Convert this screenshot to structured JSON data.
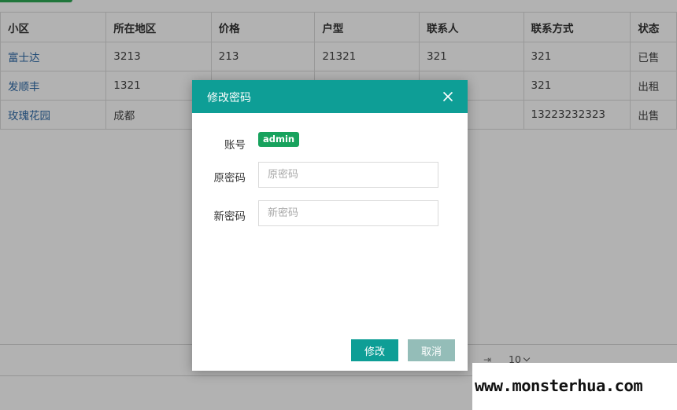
{
  "table": {
    "headers": [
      "小区",
      "所在地区",
      "价格",
      "户型",
      "联系人",
      "联系方式",
      "状态"
    ],
    "rows": [
      [
        "富士达",
        "3213",
        "213",
        "21321",
        "321",
        "321",
        "已售"
      ],
      [
        "发顺丰",
        "1321",
        "",
        "",
        "",
        "321",
        "出租"
      ],
      [
        "玫瑰花园",
        "成都",
        "",
        "",
        "",
        "13223232323",
        "出售"
      ]
    ]
  },
  "pager": {
    "page_size": "10"
  },
  "dialog": {
    "title": "修改密码",
    "account_label": "账号",
    "account_value": "admin",
    "old_password_label": "原密码",
    "old_password_placeholder": "原密码",
    "new_password_label": "新密码",
    "new_password_placeholder": "新密码",
    "submit_label": "修改",
    "cancel_label": "取消"
  },
  "watermark": {
    "text": "www.monsterhua.com"
  },
  "colors": {
    "accent": "#0e9e96",
    "badge": "#17a25d",
    "link": "#2e6aa8"
  }
}
